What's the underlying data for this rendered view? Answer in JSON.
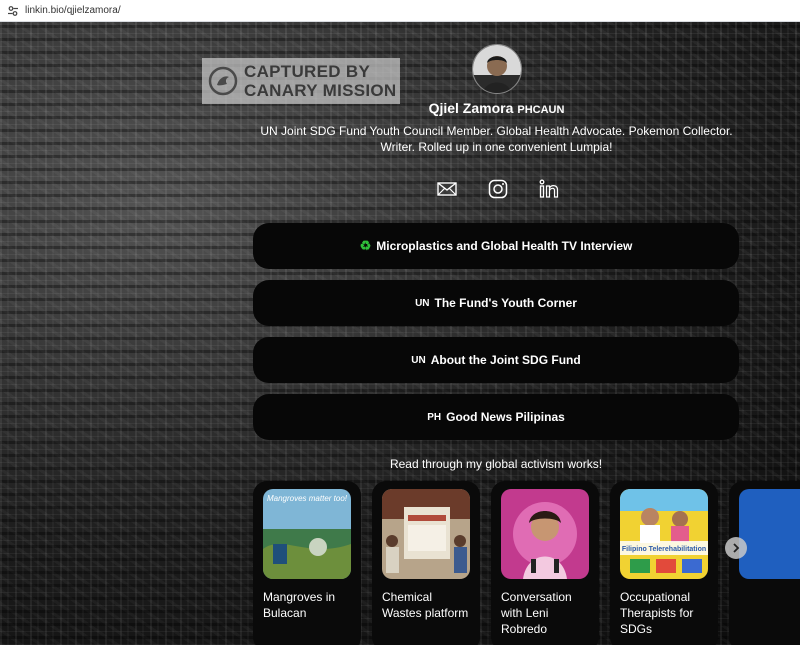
{
  "browser": {
    "url": "linkin.bio/qjielzamora/",
    "site_icon": "tune-icon"
  },
  "watermark": {
    "line1": "CAPTURED BY",
    "line2": "CANARY MISSION"
  },
  "profile": {
    "name": "Qjiel Zamora",
    "name_tag": "PHCAUN",
    "bio": "UN Joint SDG Fund Youth Council Member. Global Health Advocate. Pokemon Collector. Writer. Rolled up in one convenient Lumpia!"
  },
  "socials": [
    {
      "icon": "email-icon"
    },
    {
      "icon": "instagram-icon"
    },
    {
      "icon": "linkedin-icon"
    }
  ],
  "links": [
    {
      "prefix": "♻️",
      "label": "Microplastics and Global Health TV Interview"
    },
    {
      "prefix": "UN",
      "label": "The Fund's Youth Corner"
    },
    {
      "prefix": "UN",
      "label": "About the Joint SDG Fund"
    },
    {
      "prefix": "PH",
      "label": "Good News Pilipinas"
    }
  ],
  "works": {
    "heading": "Read through my global activism works!",
    "cards": [
      {
        "title": "Mangroves in Bulacan",
        "thumb_text": "Mangroves matter too!"
      },
      {
        "title": "Chemical Wastes platform",
        "thumb_text": ""
      },
      {
        "title": "Conversation with Leni Robredo",
        "thumb_text": ""
      },
      {
        "title": "Occupational Therapists for SDGs",
        "thumb_text": "Filipino Telerehabilitation"
      }
    ]
  },
  "colors": {
    "button_bg": "#070707",
    "text": "#ffffff",
    "recycle_green": "#2fbf3a"
  }
}
